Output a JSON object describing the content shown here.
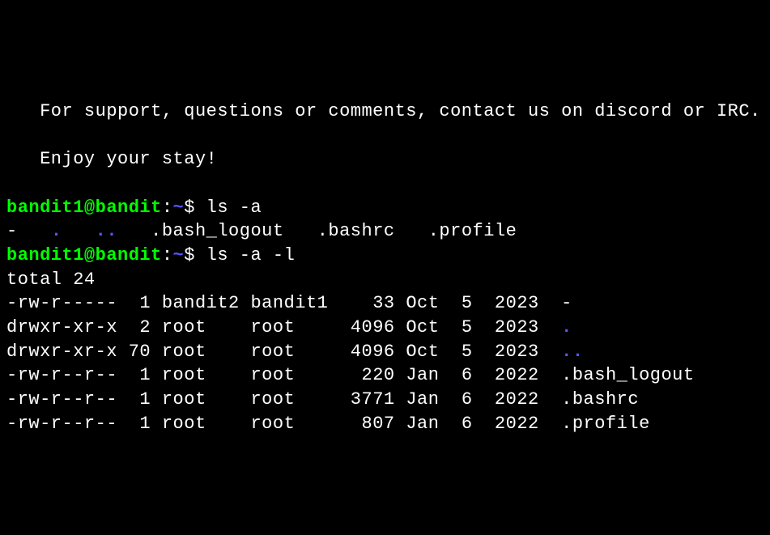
{
  "motd": {
    "line1_indent": "   ",
    "line1": "For support, questions or comments, contact us on discord or IRC.",
    "line2_indent": "   ",
    "line2": "Enjoy your stay!"
  },
  "prompt": {
    "user": "bandit1@bandit",
    "colon": ":",
    "path": "~",
    "suffix": "$ "
  },
  "cmd1": "ls -a",
  "ls_a_output": {
    "dash": "-",
    "sep1": "   ",
    "dot": ".",
    "sep2": "   ",
    "dotdot": "..",
    "sep3": "   ",
    "f1": ".bash_logout",
    "sep4": "   ",
    "f2": ".bashrc",
    "sep5": "   ",
    "f3": ".profile"
  },
  "cmd2": "ls -a -l",
  "total_line": "total 24",
  "rows": [
    {
      "perm": "-rw-r-----",
      "links": " 1",
      "owner": "bandit2",
      "group": "bandit1",
      "size": "  33",
      "date": "Oct  5  2023",
      "name": "-",
      "is_dir": false
    },
    {
      "perm": "drwxr-xr-x",
      "links": " 2",
      "owner": "root   ",
      "group": "root   ",
      "size": "4096",
      "date": "Oct  5  2023",
      "name": ".",
      "is_dir": true
    },
    {
      "perm": "drwxr-xr-x",
      "links": "70",
      "owner": "root   ",
      "group": "root   ",
      "size": "4096",
      "date": "Oct  5  2023",
      "name": "..",
      "is_dir": true
    },
    {
      "perm": "-rw-r--r--",
      "links": " 1",
      "owner": "root   ",
      "group": "root   ",
      "size": " 220",
      "date": "Jan  6  2022",
      "name": ".bash_logout",
      "is_dir": false
    },
    {
      "perm": "-rw-r--r--",
      "links": " 1",
      "owner": "root   ",
      "group": "root   ",
      "size": "3771",
      "date": "Jan  6  2022",
      "name": ".bashrc",
      "is_dir": false
    },
    {
      "perm": "-rw-r--r--",
      "links": " 1",
      "owner": "root   ",
      "group": "root   ",
      "size": " 807",
      "date": "Jan  6  2022",
      "name": ".profile",
      "is_dir": false
    }
  ]
}
